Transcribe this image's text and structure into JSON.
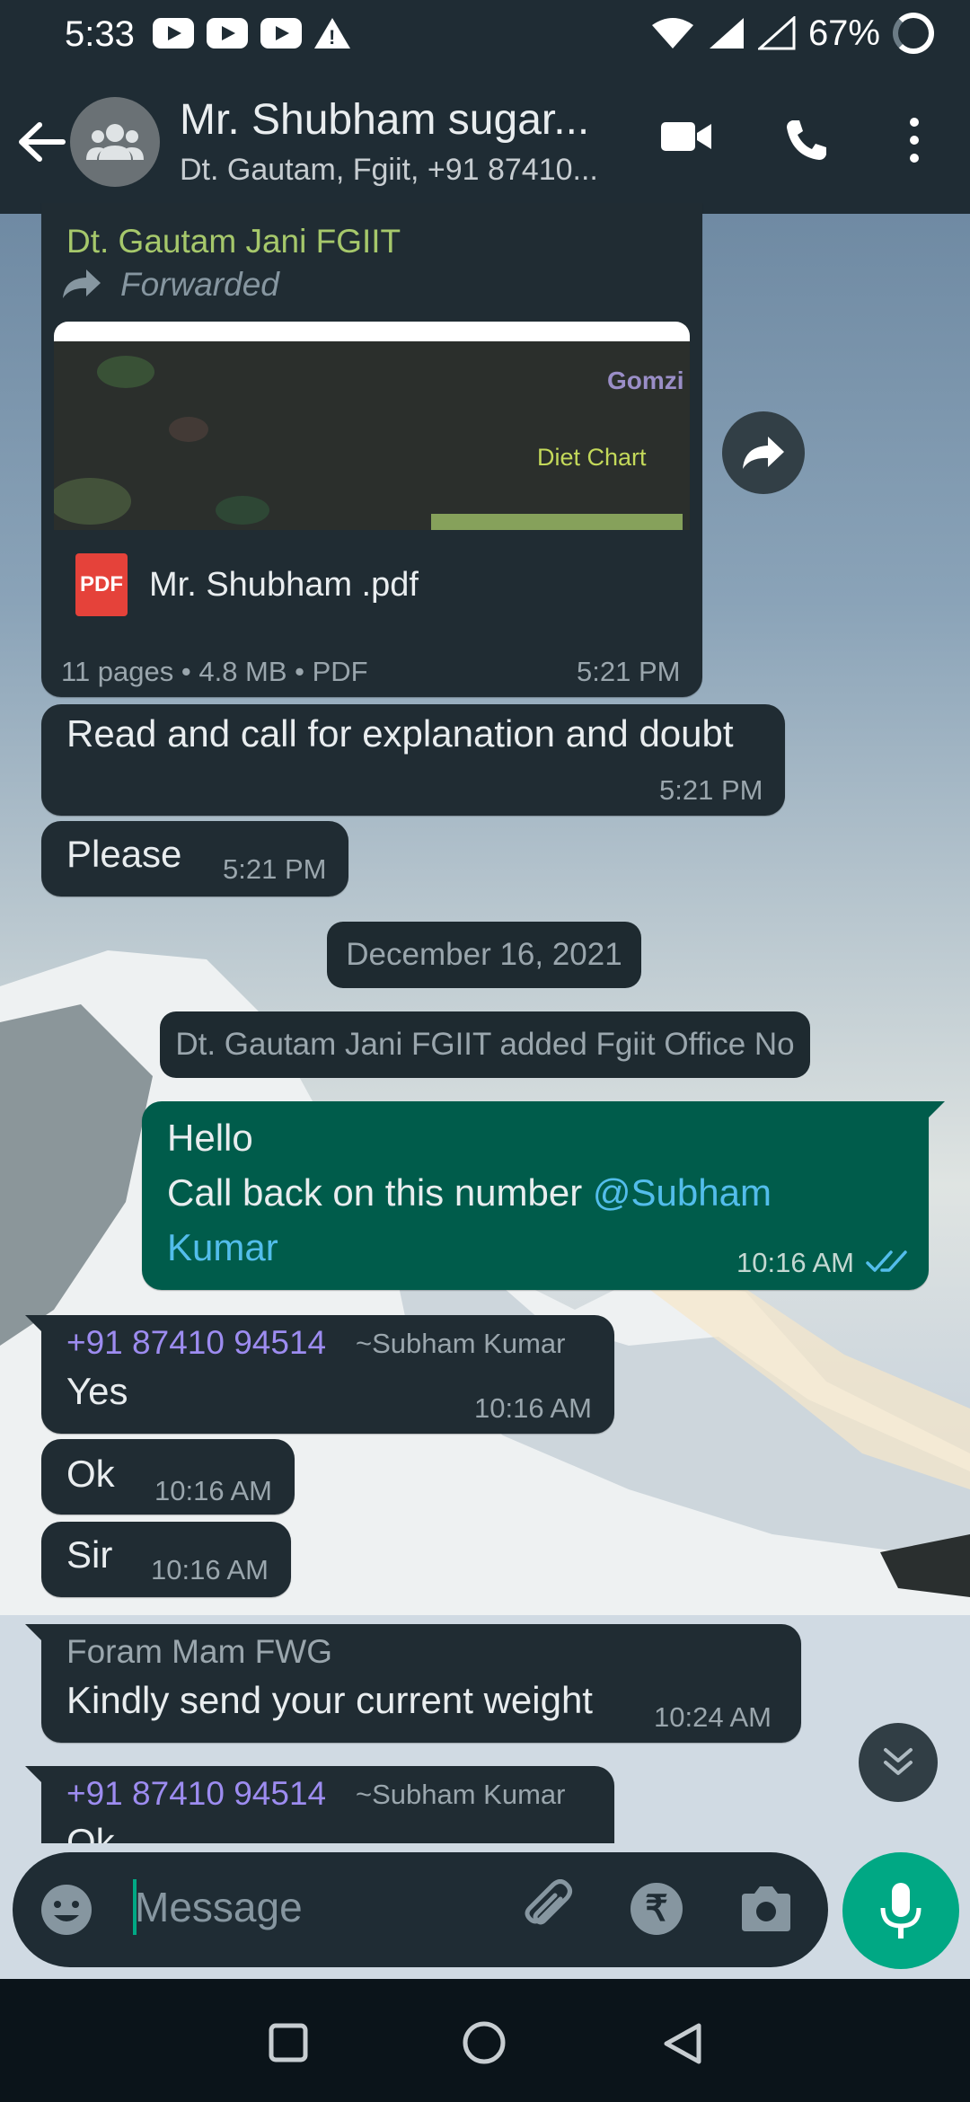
{
  "status_bar": {
    "time": "5:33",
    "battery": "67%"
  },
  "header": {
    "title": "Mr. Shubham sugar...",
    "subtitle": "Dt. Gautam, Fgiit, +91 87410..."
  },
  "colors": {
    "accent": "#00a884",
    "outgoing_bubble": "#005c4b",
    "incoming_bubble": "#202c33",
    "header": "#1f2c34",
    "link": "#53bdeb"
  },
  "document_message": {
    "sender": "Dt. Gautam Jani FGIIT",
    "forwarded_label": "Forwarded",
    "thumb_title": "Diet Chart",
    "thumb_logo": "Gomzi",
    "file_name": "Mr. Shubham .pdf",
    "pdf_badge": "PDF",
    "meta": "11 pages • 4.8 MB • PDF",
    "time": "5:21 PM"
  },
  "messages": {
    "m1": {
      "text": "Read and call for explanation and doubt",
      "time": "5:21 PM"
    },
    "m2": {
      "text": "Please",
      "time": "5:21 PM"
    },
    "date_pill": "December 16, 2021",
    "system_pill": "Dt. Gautam Jani FGIIT added Fgiit Office No",
    "out1": {
      "line1": "Hello",
      "line2": "Call back on this number ",
      "mention_a": "@Subham",
      "mention_b": "Kumar",
      "time": "10:16 AM"
    },
    "m3": {
      "sender": "+91 87410 94514",
      "push_name": "~Subham Kumar",
      "text": "Yes",
      "time": "10:16 AM"
    },
    "m4": {
      "text": "Ok",
      "time": "10:16 AM"
    },
    "m5": {
      "text": "Sir",
      "time": "10:16 AM"
    },
    "m6": {
      "sender": "Foram Mam FWG",
      "text": "Kindly send your current weight",
      "time": "10:24 AM"
    },
    "m7": {
      "sender": "+91 87410 94514",
      "push_name": "~Subham Kumar",
      "text": "Ok"
    }
  },
  "input": {
    "placeholder": "Message"
  },
  "icons": [
    "back-arrow-icon",
    "group-avatar-icon",
    "video-call-icon",
    "phone-icon",
    "more-icon",
    "forward-icon",
    "double-check-icon",
    "scroll-down-icon",
    "emoji-icon",
    "attach-icon",
    "rupee-icon",
    "camera-icon",
    "mic-icon",
    "recents-icon",
    "home-icon",
    "back-nav-icon"
  ]
}
